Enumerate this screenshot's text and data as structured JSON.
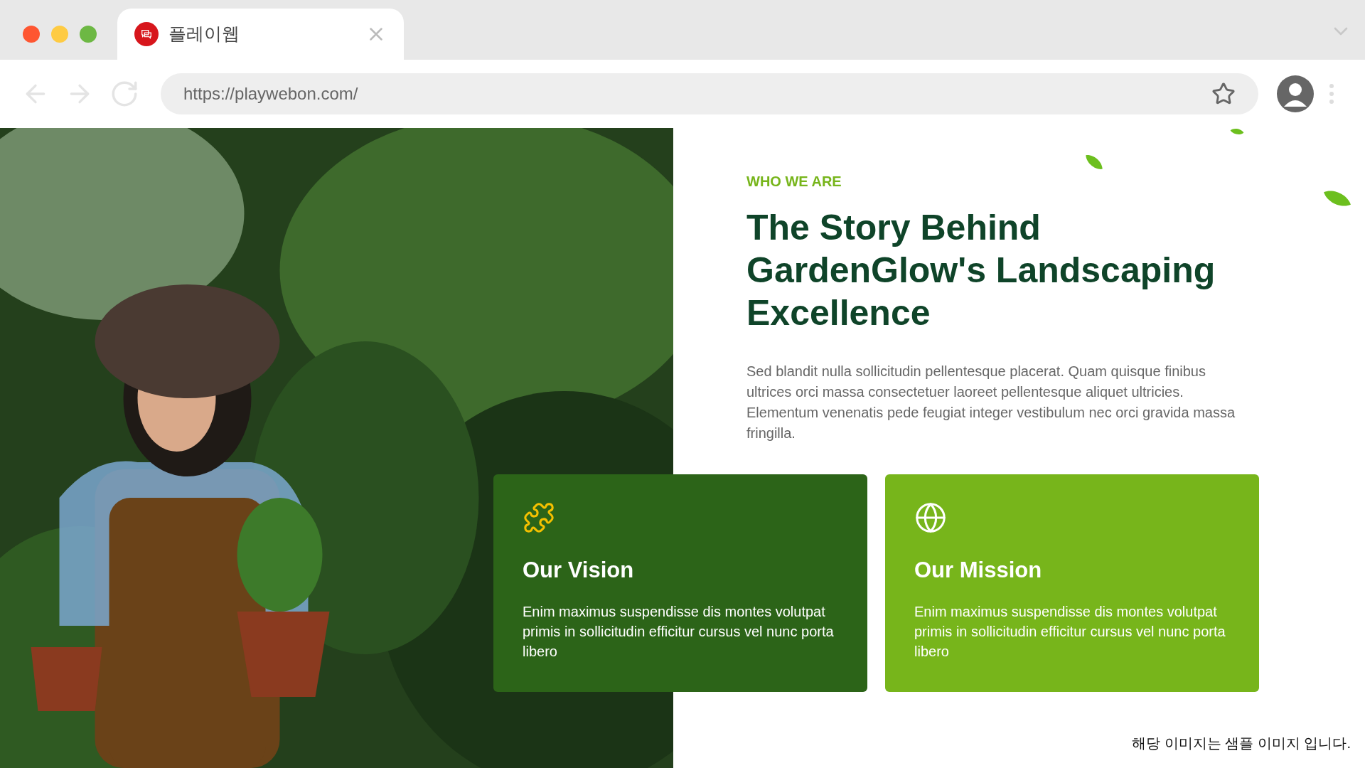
{
  "browser": {
    "tab": {
      "title": "플레이웹",
      "selected": true
    },
    "url": "https://playwebon.com/"
  },
  "section": {
    "eyebrow": "WHO WE ARE",
    "heading": "The Story Behind GardenGlow's Landscaping Excellence",
    "body": "Sed blandit nulla sollicitudin pellentesque placerat. Quam quisque finibus ultrices orci massa consectetuer laoreet pellentesque aliquet ultricies. Elementum venenatis pede feugiat integer vestibulum nec orci gravida massa fringilla."
  },
  "cards": [
    {
      "kind": "vision",
      "title": "Our Vision",
      "text": "Enim maximus suspendisse dis montes volutpat primis in sollicitudin efficitur cursus vel nunc porta libero",
      "color": "#2c6418"
    },
    {
      "kind": "mission",
      "title": "Our Mission",
      "text": "Enim maximus suspendisse dis montes volutpat primis in sollicitudin efficitur cursus vel nunc porta libero",
      "color": "#77b51b"
    }
  ],
  "note": "해당 이미지는 샘플 이미지 입니다."
}
